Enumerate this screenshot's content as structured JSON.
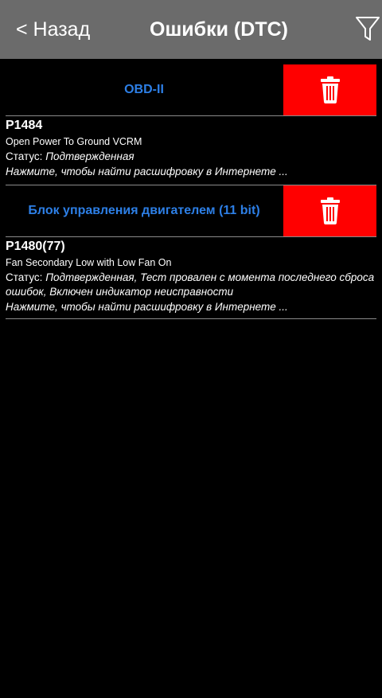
{
  "header": {
    "back_label": "< Назад",
    "title": "Ошибки (DTC)"
  },
  "sections": [
    {
      "label": "OBD-II",
      "dtcs": [
        {
          "code": "P1484",
          "description": "Open Power To Ground VCRM",
          "status_prefix": "Статус: ",
          "status_value": "Подтвержденная",
          "search_hint": "Нажмите, чтобы найти расшифровку в Интернете ..."
        }
      ]
    },
    {
      "label": "Блок управления двигателем (11 bit)",
      "dtcs": [
        {
          "code": "P1480(77)",
          "description": "Fan Secondary Low with Low Fan On",
          "status_prefix": "Статус: ",
          "status_value": "Подтвержденная, Тест провален с момента последнего сброса ошибок, Включен индикатор неисправности",
          "search_hint": "Нажмите, чтобы найти расшифровку в Интернете ..."
        }
      ]
    }
  ],
  "icons": {
    "back": "back-icon",
    "filter": "filter-icon",
    "delete": "trash-icon"
  },
  "colors": {
    "topbar": "#6b6b6b",
    "section_label": "#2d7fe6",
    "delete_button": "#ff0000",
    "background": "#000000"
  }
}
